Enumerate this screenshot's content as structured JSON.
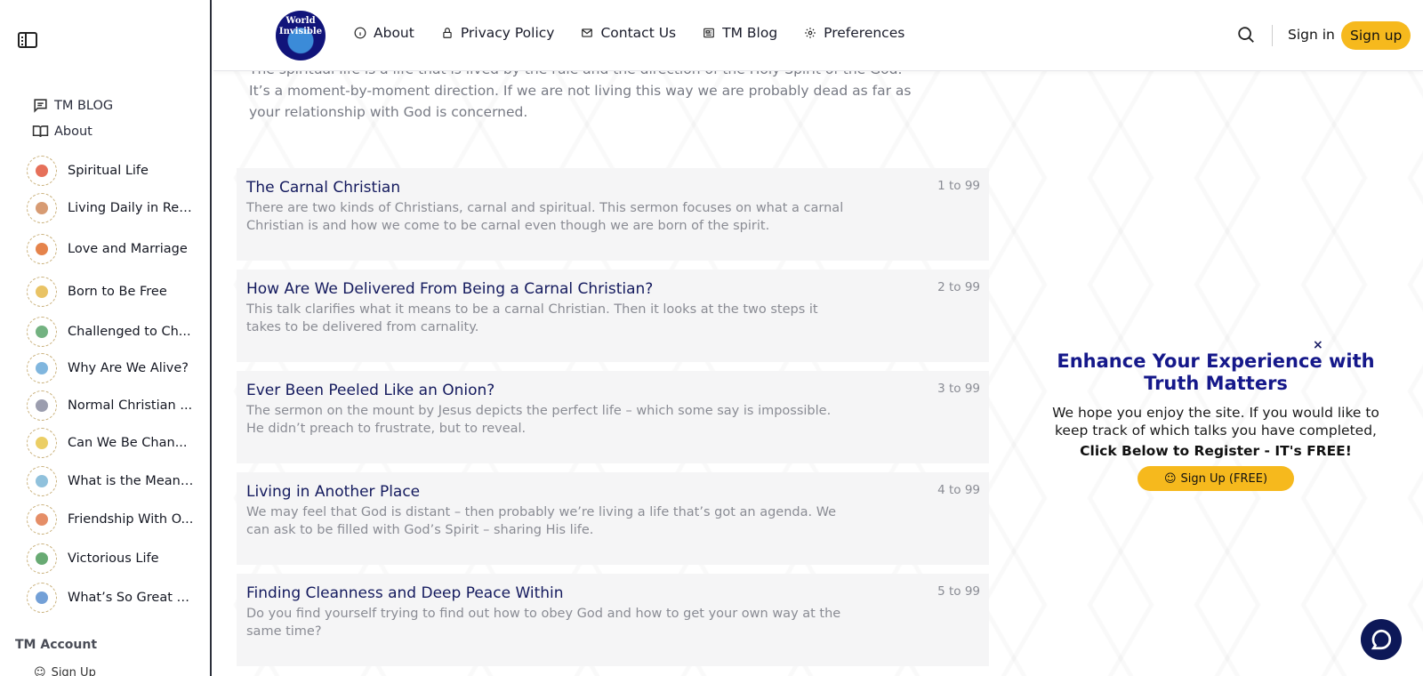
{
  "sidebar": {
    "links": [
      {
        "label": "TM BLOG",
        "icon": "message-square-icon"
      },
      {
        "label": "About",
        "icon": "book-open-icon"
      }
    ],
    "topics": [
      {
        "label": "Spiritual Life",
        "color": "#e2573d"
      },
      {
        "label": "Living Daily in Rea...",
        "color": "#d08a5b"
      },
      {
        "label": "Love and Marriage",
        "color": "#e06d2c"
      },
      {
        "label": "Born to Be Free",
        "color": "#e5b94a"
      },
      {
        "label": "Challenged to Ch...",
        "color": "#5aa46b"
      },
      {
        "label": "Why Are We Alive?",
        "color": "#6aa9d8"
      },
      {
        "label": "Normal Christian ...",
        "color": "#8a8ca0"
      },
      {
        "label": "Can We Be Chan...",
        "color": "#e8c64a"
      },
      {
        "label": "What is the Meani...",
        "color": "#7cb6d6"
      },
      {
        "label": "Friendship With O...",
        "color": "#e07a4c"
      },
      {
        "label": "Victorious Life",
        "color": "#4e9b5a"
      },
      {
        "label": "What’s So Great A...",
        "color": "#5a8fd0"
      }
    ],
    "account_heading": "TM Account",
    "account_link": "Sign Up"
  },
  "header": {
    "logo_text": "World Invisible",
    "nav": [
      {
        "label": "About",
        "icon": "info-icon"
      },
      {
        "label": "Privacy Policy",
        "icon": "lock-icon"
      },
      {
        "label": "Contact Us",
        "icon": "mail-icon"
      },
      {
        "label": "TM Blog",
        "icon": "newspaper-icon"
      },
      {
        "label": "Preferences",
        "icon": "gear-icon"
      }
    ],
    "signin": "Sign in",
    "signup": "Sign up"
  },
  "main": {
    "intro": "The spiritual life is a life that is lived by the rule and the direction of the Holy Spirit of the God. It’s a moment-by-moment direction. If we are not living this way we are probably dead as far as your relationship with God is concerned.",
    "sermons": [
      {
        "title": "The Carnal Christian",
        "desc": "There are two kinds of Christians, carnal and spiritual. This sermon focuses on what a carnal Christian is and how we come to be carnal even though we are born of the spirit.",
        "count": "1 to 99"
      },
      {
        "title": "How Are We Delivered From Being a Carnal Christian?",
        "desc": "This talk clarifies what it means to be a carnal Christian. Then it looks at the two steps it takes to be delivered from carnality.",
        "count": "2 to 99"
      },
      {
        "title": "Ever Been Peeled Like an Onion?",
        "desc": "The sermon on the mount by Jesus depicts the perfect life – which some say is impossible. He didn’t preach to frustrate, but to reveal.",
        "count": "3 to 99"
      },
      {
        "title": "Living in Another Place",
        "desc": "We may feel that God is distant – then probably we’re living a life that’s got an agenda. We can ask to be filled with God’s Spirit – sharing His life.",
        "count": "4 to 99"
      },
      {
        "title": "Finding Cleanness and Deep Peace Within",
        "desc": "Do you find yourself trying to find out how to obey God and how to get your own way at the same time?",
        "count": "5 to 99"
      }
    ]
  },
  "promo": {
    "close": "×",
    "title": "Enhance Your Experience with Truth Matters",
    "text": "We hope you enjoy the site. If you would like to keep track of which talks you have completed,",
    "cta": "Click Below to Register - IT's FREE!",
    "button": "Sign Up (FREE)"
  },
  "colors": {
    "accent": "#f6b91d",
    "navy": "#15188a"
  }
}
